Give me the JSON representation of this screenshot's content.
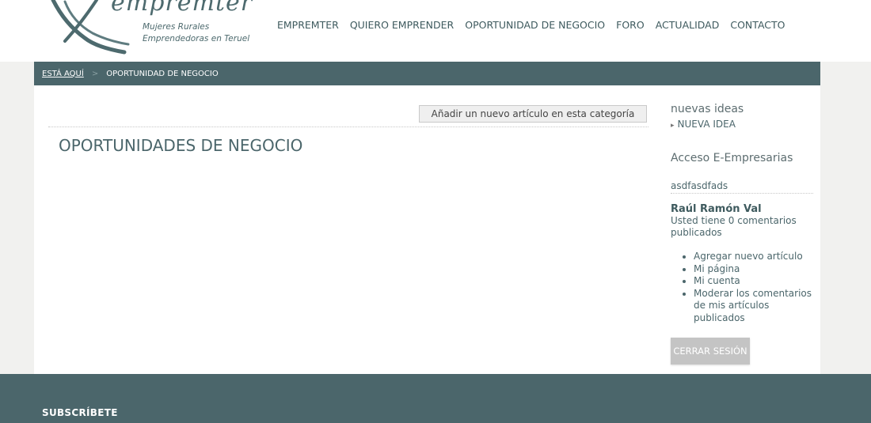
{
  "header": {
    "logo_word": "empremter",
    "logo_tagline_line1": "Mujeres Rurales",
    "logo_tagline_line2": "Emprendedoras en Teruel",
    "nav": [
      "EMPREMTER",
      "QUIERO EMPRENDER",
      "OPORTUNIDAD DE NEGOCIO",
      "FORO",
      "ACTUALIDAD",
      "CONTACTO"
    ]
  },
  "breadcrumb": {
    "label": "ESTÁ AQUÍ",
    "separator": ">",
    "current": "OPORTUNIDAD DE NEGOCIO"
  },
  "main": {
    "add_article_label": "Añadir un nuevo artículo en esta categoría",
    "page_title": "OPORTUNIDADES DE NEGOCIO"
  },
  "sidebar": {
    "ideas_heading": "nuevas ideas",
    "new_idea_link": "NUEVA IDEA",
    "access_heading": "Acceso E-Empresarias",
    "username": "asdfasdfads",
    "full_name": "Raúl Ramón Val",
    "comment_note": "Usted tiene 0 comentarios publicados",
    "links": [
      "Agregar nuevo artículo",
      "Mi página",
      "Mi cuenta",
      "Moderar los comentarios de mis artículos publicados"
    ],
    "logout_label": "CERRAR SESIÓN"
  },
  "footer": {
    "subscribe_label": "SUBSCRÍBETE"
  },
  "colors": {
    "brand_teal": "#4b666b",
    "page_background": "#f1f1ef"
  }
}
